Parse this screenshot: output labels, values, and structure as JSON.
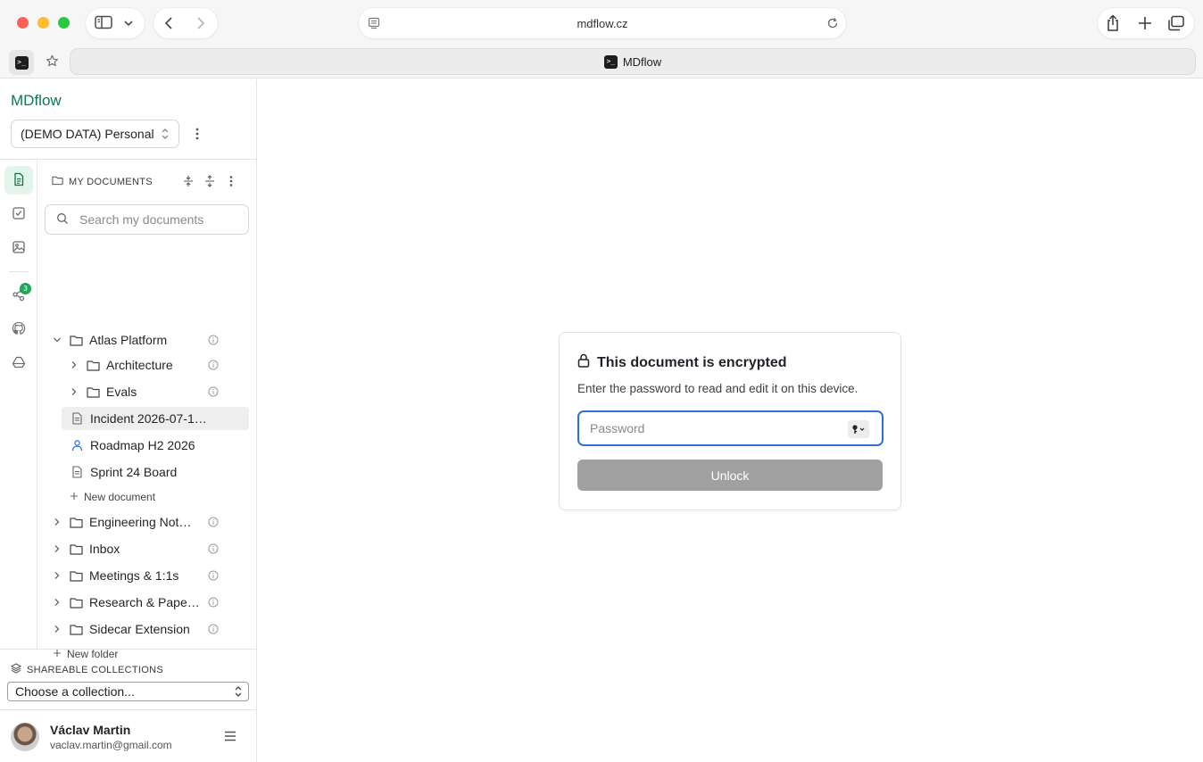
{
  "browser": {
    "url": "mdflow.cz",
    "tab_title": "MDflow"
  },
  "sidebar": {
    "brand": "MDflow",
    "workspace": "(DEMO DATA) Personal",
    "rail_badge": "3",
    "docs_header": "MY DOCUMENTS",
    "search_placeholder": "Search my documents",
    "tree": {
      "atlas": "Atlas Platform",
      "architecture": "Architecture",
      "evals": "Evals",
      "incident": "Incident 2026-07-1…",
      "roadmap": "Roadmap H2 2026",
      "sprint": "Sprint 24 Board",
      "new_document": "New document",
      "engineering": "Engineering Not…",
      "inbox": "Inbox",
      "meetings": "Meetings & 1:1s",
      "research": "Research & Pape…",
      "sidecar": "Sidecar Extension",
      "new_folder": "New folder"
    },
    "shareable": {
      "title": "SHAREABLE COLLECTIONS",
      "select_value": "Choose a collection..."
    },
    "user": {
      "name": "Václav Martin",
      "email": "vaclav.martin@gmail.com"
    }
  },
  "dialog": {
    "title": "This document is encrypted",
    "subtitle": "Enter the password to read and edit it on this device.",
    "password_placeholder": "Password",
    "unlock_label": "Unlock"
  },
  "colors": {
    "brand": "#0b7a4b",
    "focus": "#2f6fdb",
    "badge": "#22a55b",
    "disabled_button": "#a0a0a0"
  }
}
